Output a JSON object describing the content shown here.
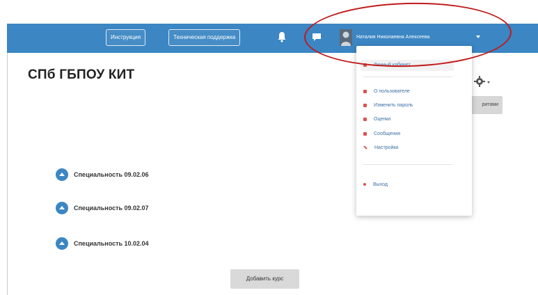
{
  "header": {
    "instructions_label": "Инструкция",
    "support_label": "Техническая поддержка",
    "user_name": "Наталия Николаевна Алексеева"
  },
  "page": {
    "title": "СПб ГБПОУ КИТ",
    "partial_button_label": "ритами"
  },
  "user_menu": {
    "items": [
      {
        "label": "Личный кабинет",
        "icon": "dashboard-icon"
      },
      {
        "label": "О пользователе",
        "icon": "user-icon"
      },
      {
        "label": "Изменить пароль",
        "icon": "key-icon"
      },
      {
        "label": "Оценки",
        "icon": "grades-icon"
      },
      {
        "label": "Сообщения",
        "icon": "message-icon"
      },
      {
        "label": "Настройки",
        "icon": "wrench-icon"
      }
    ],
    "logout_label": "Выход"
  },
  "courses": [
    {
      "label": "Специальность 09.02.06"
    },
    {
      "label": "Специальность 09.02.07"
    },
    {
      "label": "Специальность 10.02.04"
    }
  ],
  "add_course_label": "Добавить курс",
  "colors": {
    "topbar": "#3b86c3",
    "annotation": "#c01a1a",
    "menu_icon": "#d9534f",
    "link": "#3b6fa3"
  }
}
